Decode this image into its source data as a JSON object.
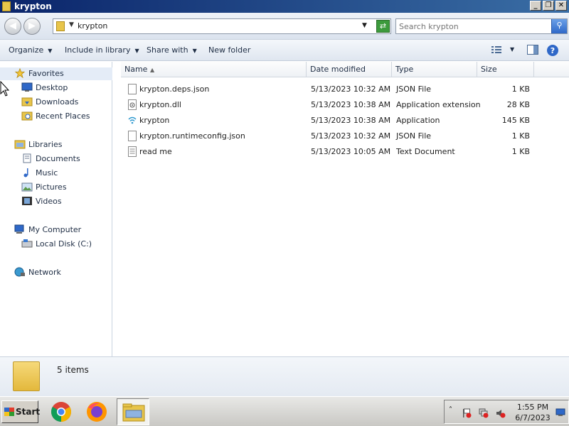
{
  "window": {
    "title": "krypton",
    "controls": {
      "minimize": "_",
      "maximize": "❐",
      "close": "✕"
    }
  },
  "addressbar": {
    "path_segment": "krypton",
    "search_placeholder": "Search krypton"
  },
  "commandbar": {
    "organize": "Organize",
    "include_in_library": "Include in library",
    "share_with": "Share with",
    "new_folder": "New folder"
  },
  "navpane": {
    "favorites": {
      "label": "Favorites",
      "items": [
        "Desktop",
        "Downloads",
        "Recent Places"
      ]
    },
    "libraries": {
      "label": "Libraries",
      "items": [
        "Documents",
        "Music",
        "Pictures",
        "Videos"
      ]
    },
    "computer": {
      "label": "My Computer",
      "items": [
        "Local Disk (C:)"
      ]
    },
    "network": {
      "label": "Network"
    }
  },
  "filelist": {
    "columns": {
      "name": "Name",
      "date": "Date modified",
      "type": "Type",
      "size": "Size"
    },
    "rows": [
      {
        "name": "krypton.deps.json",
        "date": "5/13/2023 10:32 AM",
        "type": "JSON File",
        "size": "1 KB",
        "icon": "json-file-icon"
      },
      {
        "name": "krypton.dll",
        "date": "5/13/2023 10:38 AM",
        "type": "Application extension",
        "size": "28 KB",
        "icon": "dll-file-icon"
      },
      {
        "name": "krypton",
        "date": "5/13/2023 10:38 AM",
        "type": "Application",
        "size": "145 KB",
        "icon": "application-icon"
      },
      {
        "name": "krypton.runtimeconfig.json",
        "date": "5/13/2023 10:32 AM",
        "type": "JSON File",
        "size": "1 KB",
        "icon": "json-file-icon"
      },
      {
        "name": "read me",
        "date": "5/13/2023 10:05 AM",
        "type": "Text Document",
        "size": "1 KB",
        "icon": "text-file-icon"
      }
    ]
  },
  "details": {
    "item_count": "5 items"
  },
  "taskbar": {
    "start_label": "Start",
    "time": "1:55 PM",
    "date": "6/7/2023"
  },
  "colors": {
    "titlebar": "#0a246a",
    "accent": "#2f68c8",
    "folder": "#e8c54a"
  }
}
